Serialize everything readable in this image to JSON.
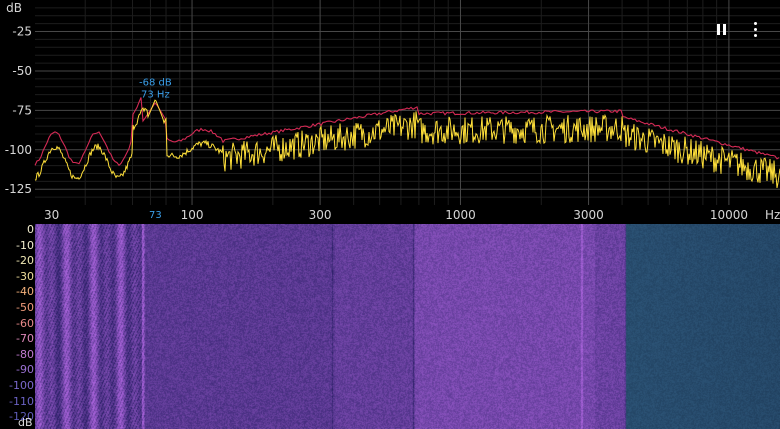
{
  "spectrum": {
    "db_unit": "dB",
    "hz_unit": "Hz",
    "db_ticks": [
      {
        "label": "-25",
        "db": -25
      },
      {
        "label": "-50",
        "db": -50
      },
      {
        "label": "-75",
        "db": -75
      },
      {
        "label": "-100",
        "db": -100
      },
      {
        "label": "-125",
        "db": -125
      }
    ],
    "freq_ticks": [
      {
        "label": "30",
        "hz": 30
      },
      {
        "label": "100",
        "hz": 100
      },
      {
        "label": "300",
        "hz": 300
      },
      {
        "label": "1000",
        "hz": 1000
      },
      {
        "label": "3000",
        "hz": 3000
      },
      {
        "label": "10000",
        "hz": 10000
      }
    ],
    "peak": {
      "db_label": "-68 dB",
      "hz_label": "73 Hz",
      "axis_label": "73",
      "hz": 73,
      "db": -68
    },
    "colors": {
      "live": "#ffe03a",
      "hold": "#d42a55",
      "peak_label": "#3a9ee8",
      "grid": "#3a3a3a"
    }
  },
  "spectrogram": {
    "db_unit": "dB",
    "db_scale": [
      {
        "label": "0",
        "color": "#f4efd0"
      },
      {
        "label": "-10",
        "color": "#f4efd0"
      },
      {
        "label": "-20",
        "color": "#f0e8b4"
      },
      {
        "label": "-30",
        "color": "#eedd9a"
      },
      {
        "label": "-40",
        "color": "#f3b07a"
      },
      {
        "label": "-50",
        "color": "#ee9a7a"
      },
      {
        "label": "-60",
        "color": "#e88a8a"
      },
      {
        "label": "-70",
        "color": "#dd88b8"
      },
      {
        "label": "-80",
        "color": "#c07ad0"
      },
      {
        "label": "-90",
        "color": "#9a70d2"
      },
      {
        "label": "-100",
        "color": "#7a68cc"
      },
      {
        "label": "-110",
        "color": "#6a62c4"
      },
      {
        "label": "-120",
        "color": "#5e5cb8"
      }
    ]
  },
  "controls": {
    "pause_icon": "pause-icon",
    "menu_icon": "more-vert-icon"
  }
}
